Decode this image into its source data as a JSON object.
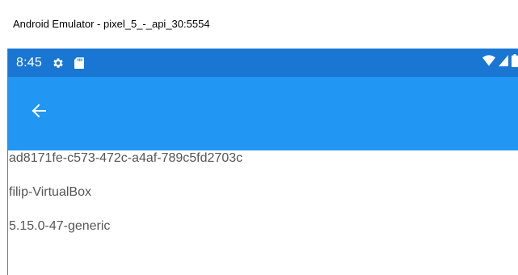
{
  "window": {
    "title": "Android Emulator - pixel_5_-_api_30:5554"
  },
  "status_bar": {
    "time": "8:45",
    "icons_left": [
      "gear-icon",
      "sd-card-icon"
    ],
    "icons_right": [
      "wifi-icon",
      "cell-signal-icon",
      "battery-icon"
    ],
    "background": "#1976d2"
  },
  "app_bar": {
    "background": "#2196f3",
    "back_icon": "arrow-left-icon"
  },
  "content": {
    "lines": [
      "ad8171fe-c573-472c-a4af-789c5fd2703c",
      "filip-VirtualBox",
      "5.15.0-47-generic"
    ],
    "text_color": "#555555"
  }
}
